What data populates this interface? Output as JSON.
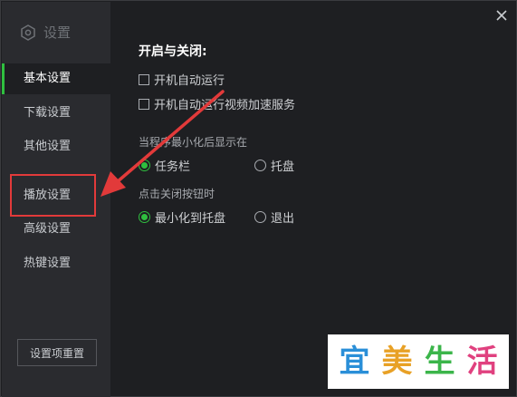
{
  "sidebar": {
    "title": "设置",
    "items": [
      {
        "label": "基本设置",
        "active": true
      },
      {
        "label": "下载设置",
        "active": false
      },
      {
        "label": "其他设置",
        "active": false
      },
      {
        "label": "播放设置",
        "active": false
      },
      {
        "label": "高级设置",
        "active": false
      },
      {
        "label": "热键设置",
        "active": false
      }
    ],
    "reset_label": "设置项重置"
  },
  "main": {
    "section_title": "开启与关闭:",
    "checkboxes": [
      {
        "label": "开机自动运行",
        "checked": false
      },
      {
        "label": "开机自动运行视频加速服务",
        "checked": false
      }
    ],
    "minimize_group": {
      "label": "当程序最小化后显示在",
      "options": [
        {
          "label": "任务栏",
          "checked": true
        },
        {
          "label": "托盘",
          "checked": false
        }
      ]
    },
    "close_group": {
      "label": "点击关闭按钮时",
      "options": [
        {
          "label": "最小化到托盘",
          "checked": true
        },
        {
          "label": "退出",
          "checked": false
        }
      ]
    }
  },
  "watermark": {
    "chars": [
      "宜",
      "美",
      "生",
      "活"
    ],
    "colors": [
      "#2a8fd8",
      "#e8a126",
      "#3bb54a",
      "#e0417f"
    ]
  },
  "colors": {
    "accent": "#2fbf3f",
    "annotation": "#e23a3a",
    "background": "#1e1f22",
    "sidebar": "#2a2b2f"
  }
}
